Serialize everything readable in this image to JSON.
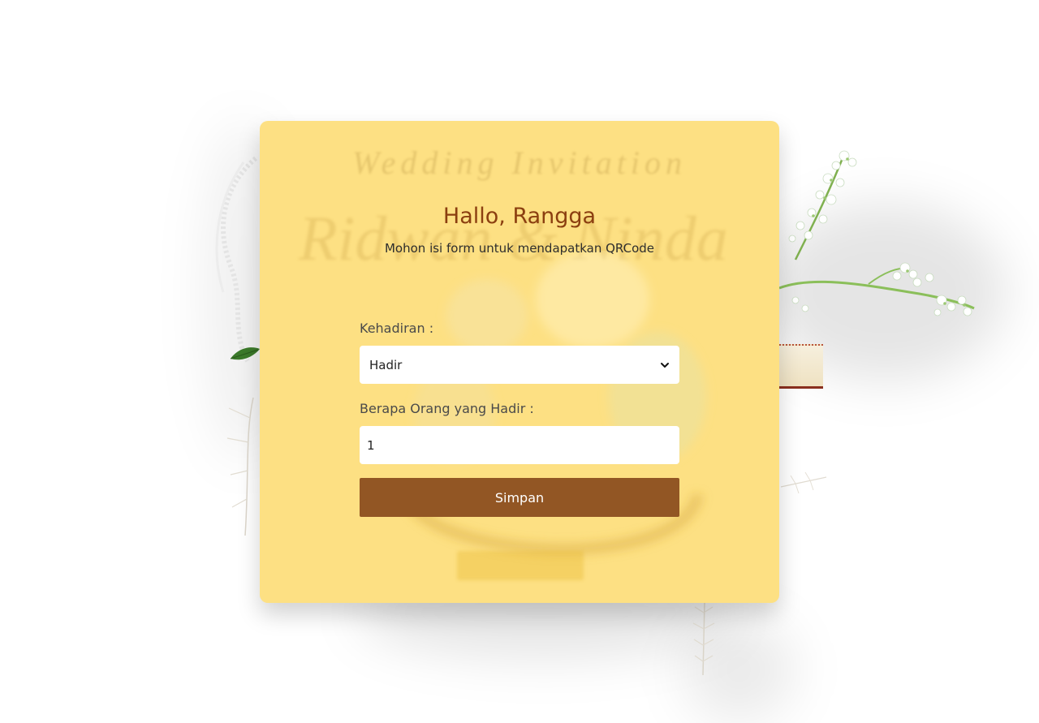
{
  "card": {
    "background_text": {
      "title": "Wedding Invitation",
      "names": "Ridwan & Ninda"
    },
    "greeting": "Hallo, Rangga",
    "instruction": "Mohon isi form untuk mendapatkan QRCode"
  },
  "form": {
    "attendance": {
      "label": "Kehadiran :",
      "selected": "Hadir"
    },
    "guest_count": {
      "label": "Berapa Orang yang Hadir :",
      "value": "1"
    },
    "submit_label": "Simpan"
  },
  "colors": {
    "card_bg": "#fde083",
    "heading": "#8b3f10",
    "button": "#925624"
  },
  "icons": {
    "select_arrow": "chevron-down-icon"
  }
}
